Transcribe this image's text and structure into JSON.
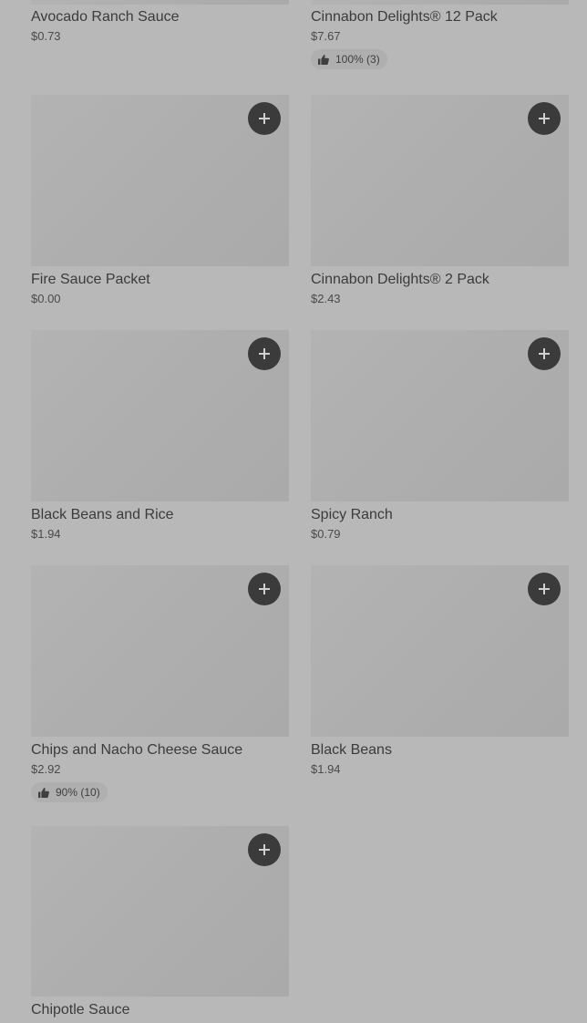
{
  "items": [
    {
      "title": "Avocado Ranch Sauce",
      "price": "$0.73",
      "rating": null
    },
    {
      "title": "Cinnabon Delights® 12 Pack",
      "price": "$7.67",
      "rating": "100% (3)"
    },
    {
      "title": "Fire Sauce Packet",
      "price": "$0.00",
      "rating": null
    },
    {
      "title": "Cinnabon Delights® 2 Pack",
      "price": "$2.43",
      "rating": null
    },
    {
      "title": "Black Beans and Rice",
      "price": "$1.94",
      "rating": null
    },
    {
      "title": "Spicy Ranch",
      "price": "$0.79",
      "rating": null
    },
    {
      "title": "Chips and Nacho Cheese Sauce",
      "price": "$2.92",
      "rating": "90% (10)"
    },
    {
      "title": "Black Beans",
      "price": "$1.94",
      "rating": null
    },
    {
      "title": "Chipotle Sauce",
      "price": "",
      "rating": null
    }
  ],
  "icons": {
    "add": "plus-icon",
    "rating": "thumbs-up-icon"
  },
  "colors": {
    "page_background": "#b8b8b8",
    "image_placeholder": "#adadad",
    "add_button": "#3b3b3b",
    "text": "#3b3b3b"
  }
}
